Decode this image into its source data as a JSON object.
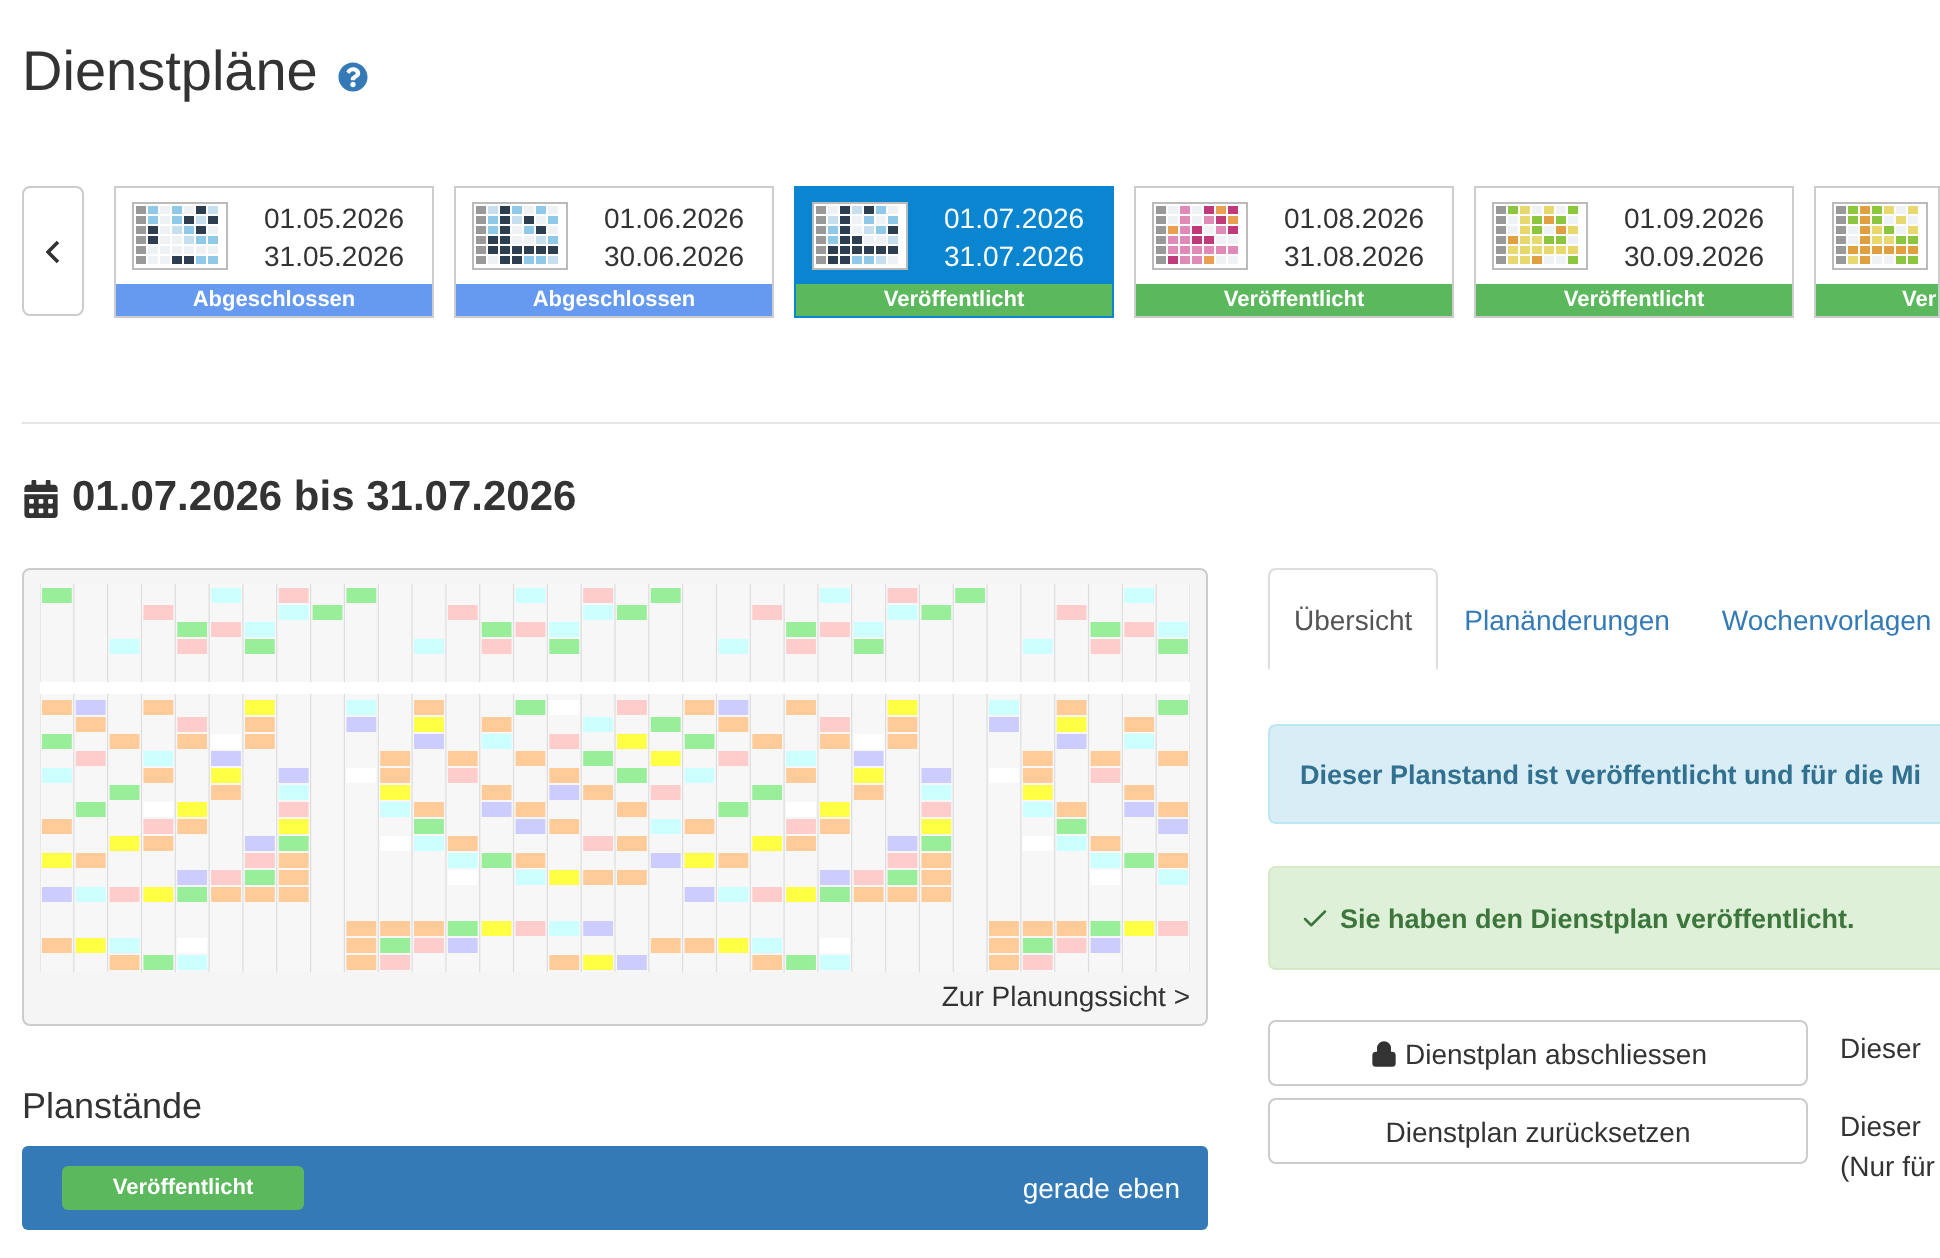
{
  "page_title": "Dienstpläne",
  "plans": [
    {
      "start": "01.05.2026",
      "end": "31.05.2026",
      "status": "Abgeschlossen",
      "kind": "closed",
      "selected": false
    },
    {
      "start": "01.06.2026",
      "end": "30.06.2026",
      "status": "Abgeschlossen",
      "kind": "closed",
      "selected": false
    },
    {
      "start": "01.07.2026",
      "end": "31.07.2026",
      "status": "Veröffentlicht",
      "kind": "published",
      "selected": true
    },
    {
      "start": "01.08.2026",
      "end": "31.08.2026",
      "status": "Veröffentlicht",
      "kind": "published",
      "selected": false
    },
    {
      "start": "01.09.2026",
      "end": "30.09.2026",
      "status": "Veröffentlicht",
      "kind": "published",
      "selected": false
    },
    {
      "status": "Ver",
      "kind": "published",
      "selected": false
    }
  ],
  "range_heading": "01.07.2026 bis 31.07.2026",
  "preview": {
    "link": "Zur Planungssicht >"
  },
  "versions": {
    "title": "Planstände",
    "items": [
      {
        "status": "Veröffentlicht",
        "time": "gerade eben"
      }
    ]
  },
  "tabs": [
    {
      "label": "Übersicht",
      "selected": true
    },
    {
      "label": "Planänderungen",
      "selected": false
    },
    {
      "label": "Wochenvorlagen",
      "selected": false
    }
  ],
  "alerts": [
    {
      "kind": "info",
      "text": "Dieser Planstand ist veröffentlicht und für die Mi"
    },
    {
      "kind": "success",
      "text": "Sie haben den Dienstplan veröffentlicht."
    }
  ],
  "actions": [
    {
      "label": "Dienstplan abschliessen",
      "note": [
        "Dieser"
      ]
    },
    {
      "label": "Dienstplan zurücksetzen",
      "note": [
        "Dieser",
        "(Nur für"
      ]
    }
  ]
}
